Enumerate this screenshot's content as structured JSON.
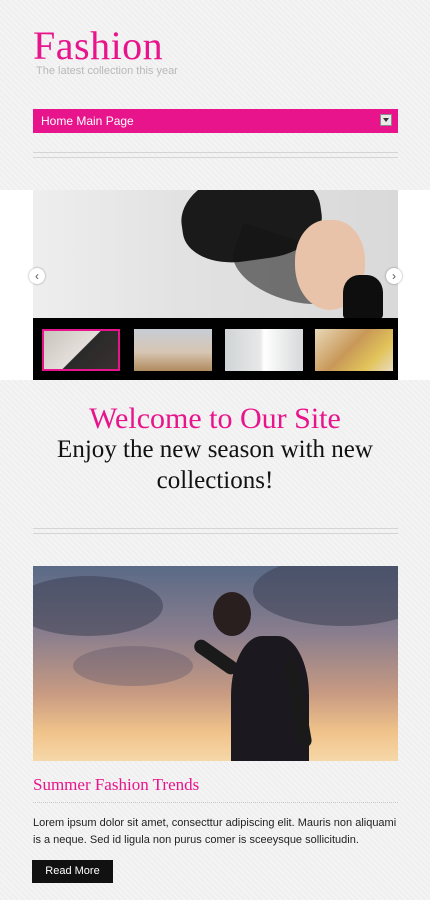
{
  "header": {
    "logo": "Fashion",
    "tagline": "The latest collection this year"
  },
  "nav": {
    "selected": "Home Main Page"
  },
  "slider": {
    "prev_icon": "‹",
    "next_icon": "›",
    "active_thumb": 0,
    "thumbnails": [
      {
        "name": "thumb-veil-woman"
      },
      {
        "name": "thumb-beach-man"
      },
      {
        "name": "thumb-white-shirt-woman"
      },
      {
        "name": "thumb-curly-hair-woman"
      }
    ]
  },
  "welcome": {
    "title": "Welcome to Our Site",
    "subtitle": "Enjoy the new season with new collections!"
  },
  "post": {
    "title": "Summer Fashion Trends",
    "body": "Lorem ipsum dolor sit amet, consecttur adipiscing elit. Mauris non aliquami is a neque. Sed id ligula non purus comer is sceeysque sollicitudin.",
    "read_more": "Read More"
  },
  "colors": {
    "accent": "#e8148c",
    "button_bg": "#111111"
  }
}
